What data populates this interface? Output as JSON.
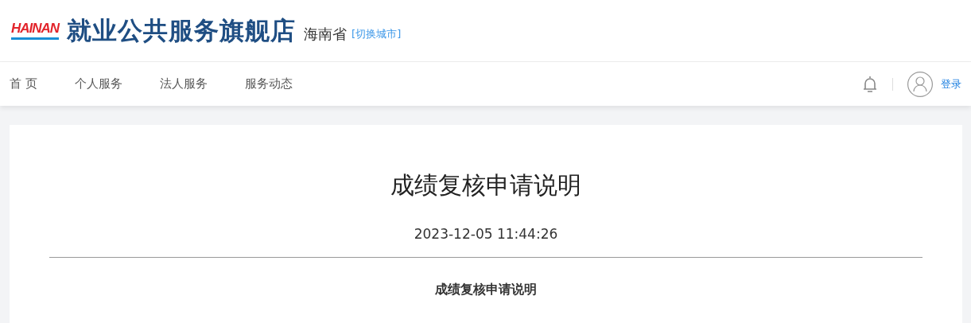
{
  "header": {
    "logo": "HAINAN",
    "title": "就业公共服务旗舰店",
    "province": "海南省",
    "switch_city": "[切换城市]"
  },
  "nav": {
    "items": [
      "首 页",
      "个人服务",
      "法人服务",
      "服务动态"
    ],
    "login": "登录"
  },
  "article": {
    "title": "成绩复核申请说明",
    "date": "2023-12-05 11:44:26",
    "subtitle": "成绩复核申请说明"
  }
}
